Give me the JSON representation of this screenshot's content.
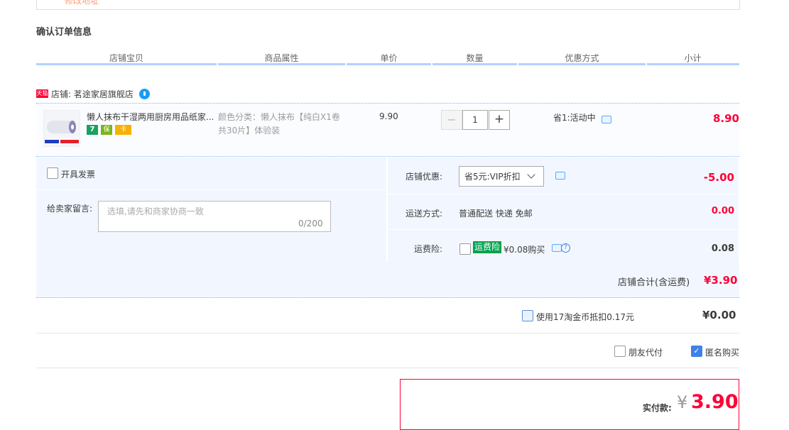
{
  "address": {
    "modify_link": "修改地址"
  },
  "section_title": "确认订单信息",
  "columns": [
    "店铺宝贝",
    "商品属性",
    "单价",
    "数量",
    "优惠方式",
    "小计"
  ],
  "shop": {
    "badge": "天猫",
    "label": "店铺: 茗途家居旗舰店"
  },
  "item": {
    "title": "懒人抹布干湿两用厨房用品纸家...",
    "sku_lines": [
      "颜色分类：懒人抹布【纯白X1卷",
      "共30片】体验装"
    ],
    "price": "9.90",
    "quantity": "1",
    "qty_minus": "−",
    "qty_plus": "+",
    "promo": "省1:活动中",
    "subtotal": "8.90",
    "service_icons": [
      "7",
      "保",
      "卡"
    ]
  },
  "invoice": {
    "label": "开具发票"
  },
  "memo": {
    "label": "给卖家留言:",
    "placeholder": "选填,请先和商家协商一致",
    "count": "0/200"
  },
  "shop_discount": {
    "label": "店铺优惠:",
    "selected": "省5元:VIP折扣",
    "amount": "-5.00"
  },
  "shipping": {
    "label": "运送方式:",
    "value": "普通配送 快递 免邮",
    "amount": "0.00"
  },
  "insurance": {
    "label": "运费险:",
    "tag": "运费险",
    "price_text": "¥0.08购买",
    "help": "?",
    "amount": "0.08"
  },
  "shop_total": {
    "label": "店铺合计(含运费)",
    "amount": "¥3.90"
  },
  "taobao_coin": {
    "label": "使用17淘金币抵扣0.17元",
    "amount": "¥0.00"
  },
  "friend_pay": {
    "label": "朋友代付",
    "checked": false
  },
  "anonymous": {
    "label": "匿名购买",
    "checked": true,
    "check_mark": "✓"
  },
  "payment": {
    "label": "实付款:",
    "currency": "¥",
    "amount": "3.90"
  },
  "colors": {
    "accent_red": "#ff0036",
    "blue_line": "#b2d1ff",
    "panel_bg": "#f2f7ff",
    "check_blue": "#3e82e9"
  }
}
